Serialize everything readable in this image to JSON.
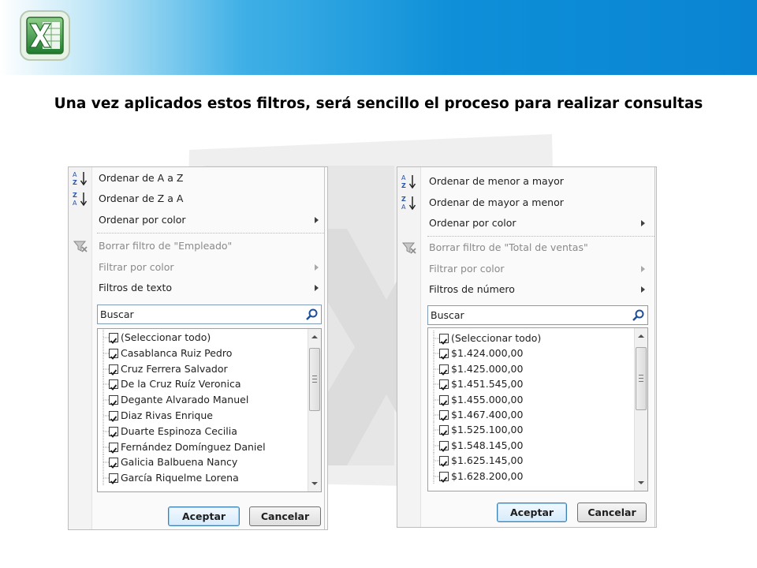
{
  "slide": {
    "title": "Una vez aplicados estos filtros, será sencillo el proceso para realizar consultas"
  },
  "colors": {
    "header_band": "#0a84d2",
    "excel_green": "#2e8b3a",
    "primary_button_border": "#3c7fb1"
  },
  "icons": {
    "header": "excel-logo-icon",
    "watermark": "excel-watermark-icon",
    "sort_az": "sort-a-to-z-icon",
    "sort_za": "sort-z-to-a-icon",
    "clear_filter": "clear-filter-icon",
    "search": "search-icon",
    "checkbox": "checkbox-checked-icon"
  },
  "left_panel": {
    "menu": {
      "sort_asc": "Ordenar de A a Z",
      "sort_desc": "Ordenar de Z a A",
      "sort_color": "Ordenar por color",
      "clear_filter": "Borrar filtro de \"Empleado\"",
      "filter_color": "Filtrar por color",
      "text_filters": "Filtros de texto"
    },
    "search_placeholder": "Buscar",
    "items": [
      "(Seleccionar todo)",
      "Casablanca Ruiz Pedro",
      "Cruz Ferrera Salvador",
      "De la Cruz Ruíz Veronica",
      "Degante Alvarado Manuel",
      "Diaz Rivas Enrique",
      "Duarte Espinoza Cecilia",
      "Fernández Domínguez Daniel",
      "Galicia Balbuena Nancy",
      "García Riquelme Lorena"
    ],
    "ok_label": "Aceptar",
    "cancel_label": "Cancelar"
  },
  "right_panel": {
    "menu": {
      "sort_asc": "Ordenar de menor a mayor",
      "sort_desc": "Ordenar de mayor a menor",
      "sort_color": "Ordenar por color",
      "clear_filter": "Borrar filtro de \"Total de ventas\"",
      "filter_color": "Filtrar por color",
      "number_filters": "Filtros de número"
    },
    "search_placeholder": "Buscar",
    "items": [
      "(Seleccionar todo)",
      "$1.424.000,00",
      "$1.425.000,00",
      "$1.451.545,00",
      "$1.455.000,00",
      "$1.467.400,00",
      "$1.525.100,00",
      "$1.548.145,00",
      "$1.625.145,00",
      "$1.628.200,00"
    ],
    "ok_label": "Aceptar",
    "cancel_label": "Cancelar"
  }
}
